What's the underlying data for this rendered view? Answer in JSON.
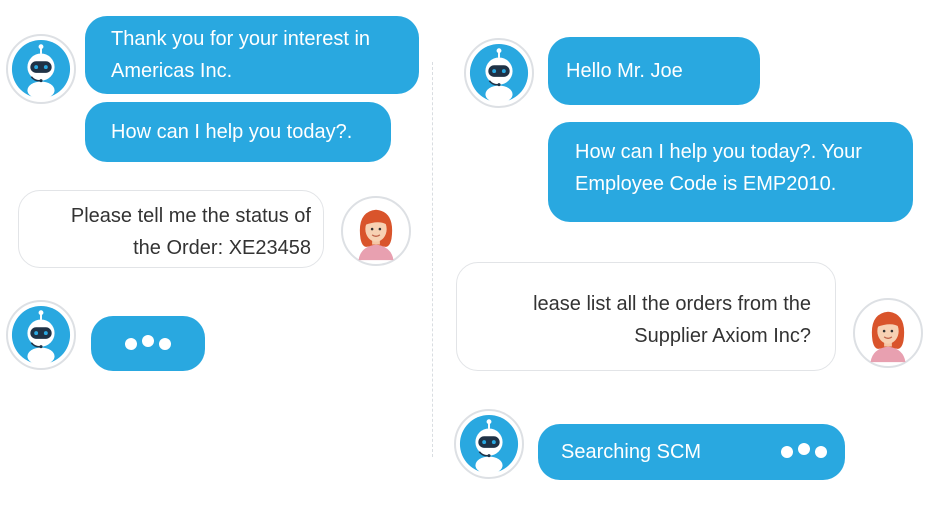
{
  "left_chat": {
    "bot_message_1": "Thank you for your interest in Americas Inc.",
    "bot_message_2": "How can I help you today?.",
    "user_message": "Please tell me the status of the Order: XE23458"
  },
  "right_chat": {
    "bot_message_1": "Hello Mr. Joe",
    "bot_message_2": "How can I help you today?. Your Employee Code is EMP2010.",
    "user_message": "lease list all the orders from the Supplier Axiom Inc?",
    "status_message": "Searching SCM"
  },
  "icons": {
    "bot_avatar": "robot-icon",
    "user_avatar": "woman-avatar-icon",
    "typing": "typing-dots-icon"
  },
  "colors": {
    "bot_bubble": "#29a8e0",
    "user_bubble_border": "#e2e4e7",
    "avatar_ring": "#dde0e4",
    "robot_head": "#1f3246",
    "hair": "#d9542b"
  }
}
